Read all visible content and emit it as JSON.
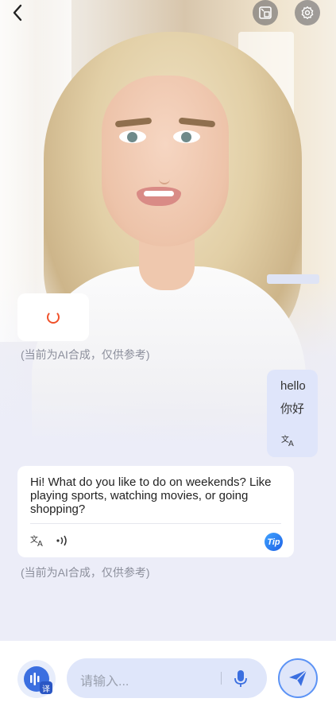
{
  "top_bar": {
    "back_icon": "chevron-left-icon",
    "mode_icon": "screen-switch-icon",
    "settings_icon": "gear-icon"
  },
  "loading_bubble": {
    "icon": "spinner-icon",
    "accent": "#f0512a"
  },
  "notes": {
    "ai_disclaimer_1": "(当前为AI合成，仅供参考)",
    "ai_disclaimer_2": "(当前为AI合成，仅供参考)"
  },
  "user_message": {
    "text": "hello",
    "translation": "你好",
    "translate_icon": "translate-icon"
  },
  "ai_message": {
    "text": "Hi! What do you like to do on weekends? Like playing sports, watching movies, or going shopping?",
    "translate_icon": "translate-icon",
    "audio_icon": "audio-wave-icon",
    "tip_label": "Tip"
  },
  "input_bar": {
    "left_button_icon": "voice-translate-icon",
    "left_button_badge": "译",
    "placeholder": "请输入...",
    "mic_icon": "microphone-icon",
    "send_icon": "send-icon"
  },
  "colors": {
    "primary": "#3b6fe0",
    "bubble_user": "#dfe5fa",
    "background": "#ecedf8"
  }
}
